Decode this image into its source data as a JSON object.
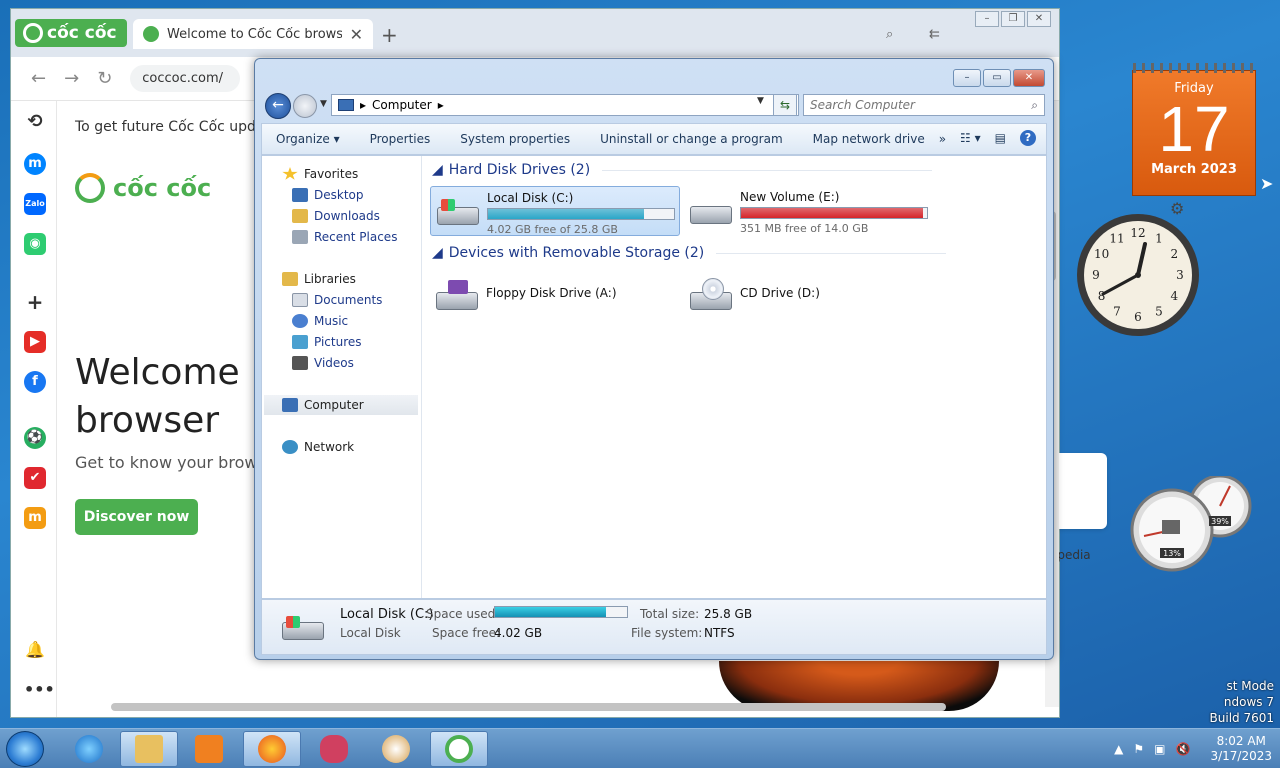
{
  "desktop": {
    "mode_line1": "st Mode",
    "mode_line2": "ndows 7",
    "mode_line3": "Build 7601"
  },
  "browser": {
    "brand": "cốc cốc",
    "tab_title": "Welcome to Cốc Cốc browse",
    "url": "coccoc.com/",
    "notice": "To get future Cốc Cốc update",
    "logo_text": "cốc cốc",
    "welcome_line1": "Welcome",
    "welcome_line2": "browser",
    "subtitle": "Get to know your brow",
    "discover_button": "Discover now",
    "wiki_label": "ipedia"
  },
  "explorer": {
    "address": "Computer",
    "search_placeholder": "Search Computer",
    "toolbar": {
      "organize": "Organize",
      "properties": "Properties",
      "system_properties": "System properties",
      "uninstall": "Uninstall or change a program",
      "map_drive": "Map network drive",
      "more": "»"
    },
    "nav": {
      "favorites": "Favorites",
      "desktop": "Desktop",
      "downloads": "Downloads",
      "recent": "Recent Places",
      "libraries": "Libraries",
      "documents": "Documents",
      "music": "Music",
      "pictures": "Pictures",
      "videos": "Videos",
      "computer": "Computer",
      "network": "Network"
    },
    "groups": {
      "hdd": "Hard Disk Drives (2)",
      "removable": "Devices with Removable Storage (2)"
    },
    "drives": [
      {
        "name": "Local Disk (C:)",
        "free": "4.02 GB free of 25.8 GB",
        "used_fraction": 0.84,
        "bar_color": "#2aa6c8"
      },
      {
        "name": "New Volume (E:)",
        "free": "351 MB free of 14.0 GB",
        "used_fraction": 0.98,
        "bar_color": "#d6242a"
      },
      {
        "name": "Floppy Disk Drive (A:)"
      },
      {
        "name": "CD Drive (D:)"
      }
    ],
    "status": {
      "name": "Local Disk (C:)",
      "type": "Local Disk",
      "space_used_label": "Space used:",
      "space_free_label": "Space free:",
      "space_free": "4.02 GB",
      "total_size_label": "Total size:",
      "total_size": "25.8 GB",
      "fs_label": "File system:",
      "fs": "NTFS",
      "used_fraction": 0.84
    }
  },
  "gadgets": {
    "calendar_dow": "Friday",
    "calendar_day": "17",
    "calendar_month": "March 2023",
    "cpu": "13%",
    "mem": "39%"
  },
  "taskbar": {
    "time": "8:02 AM",
    "date": "3/17/2023"
  }
}
